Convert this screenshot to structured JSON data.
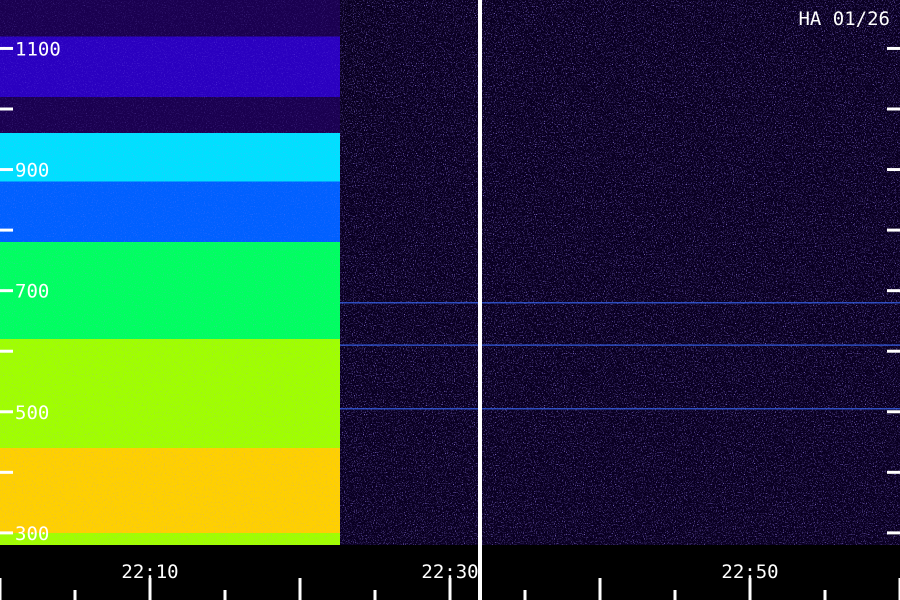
{
  "chart_data": {
    "type": "heatmap",
    "title": "HA 01/26",
    "x_tick_labels": [
      "22:10",
      "22:30",
      "22:50"
    ],
    "y_tick_labels": [
      "1100",
      "900",
      "700",
      "500",
      "300"
    ],
    "ylim": [
      280,
      1180
    ],
    "colormap": [
      "#000000",
      "#1a0050",
      "#2a00c0",
      "#0060ff",
      "#00e0ff",
      "#00ff60",
      "#a0ff00",
      "#ffd000",
      "#ff2000"
    ],
    "bands": [
      {
        "y_from": 1180,
        "y_to": 1120,
        "level": 0.15
      },
      {
        "y_from": 1120,
        "y_to": 1020,
        "level": 0.3
      },
      {
        "y_from": 1020,
        "y_to": 960,
        "level": 0.15
      },
      {
        "y_from": 960,
        "y_to": 880,
        "level": 0.45
      },
      {
        "y_from": 880,
        "y_to": 780,
        "level": 0.4
      },
      {
        "y_from": 780,
        "y_to": 700,
        "level": 0.6
      },
      {
        "y_from": 700,
        "y_to": 620,
        "level": 0.62
      },
      {
        "y_from": 620,
        "y_to": 560,
        "level": 0.7
      },
      {
        "y_from": 560,
        "y_to": 500,
        "level": 0.75
      },
      {
        "y_from": 500,
        "y_to": 440,
        "level": 0.72
      },
      {
        "y_from": 440,
        "y_to": 360,
        "level": 0.92
      },
      {
        "y_from": 360,
        "y_to": 300,
        "level": 0.85
      },
      {
        "y_from": 300,
        "y_to": 280,
        "level": 0.7
      }
    ],
    "background_level": 0.1,
    "interference_lines_mhz": [
      680,
      610,
      505
    ],
    "grid": false
  }
}
